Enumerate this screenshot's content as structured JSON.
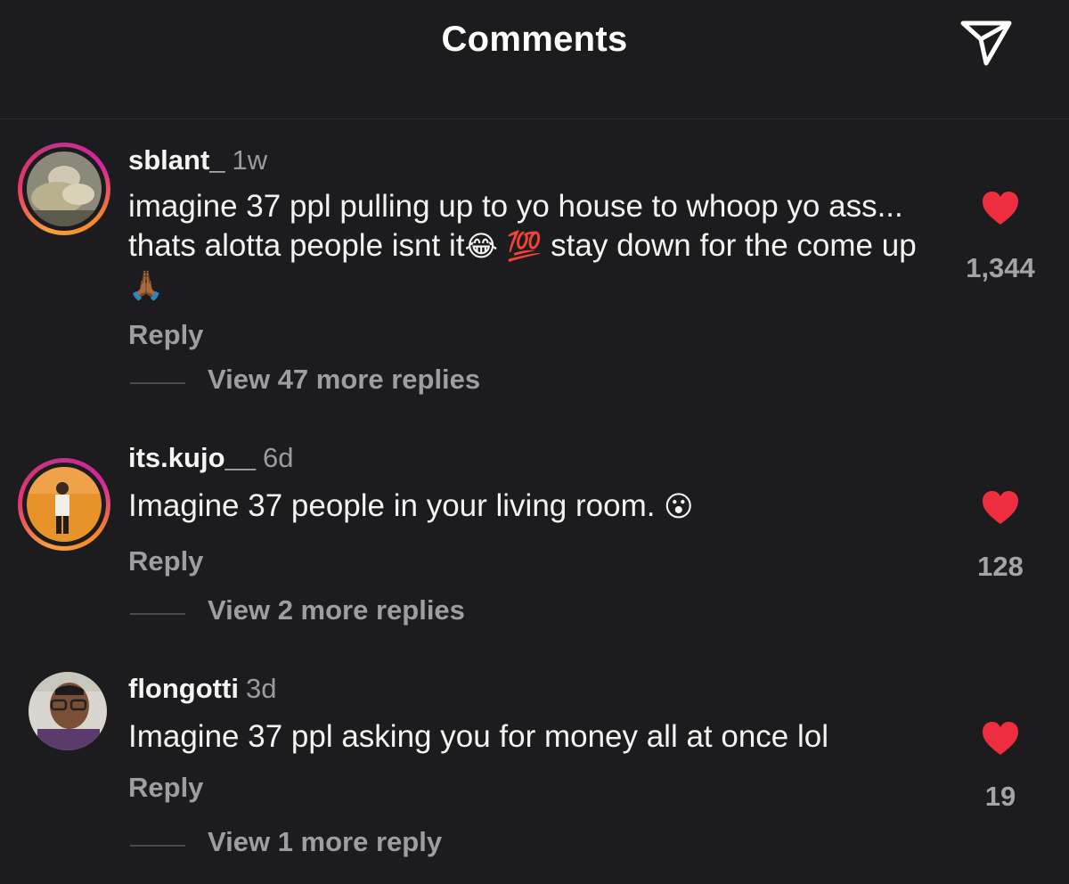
{
  "header": {
    "title": "Comments",
    "share_icon": "paper-plane-icon"
  },
  "colors": {
    "background": "#1c1c1f",
    "like_heart": "#ee2e3e",
    "muted_text": "#9d9da3",
    "story_ring": [
      "#f9a13a",
      "#e8356a",
      "#c13584"
    ]
  },
  "comments": [
    {
      "username": "sblant_",
      "time": "1w",
      "text_parts": [
        "imagine 37 ppl pulling up to yo house to whoop yo ass... thats alotta people isnt it",
        "😂",
        "💯",
        " stay down for the come up",
        "🙏🏾"
      ],
      "reply_label": "Reply",
      "view_replies": "View 47 more replies",
      "likes": "1,344",
      "liked": true,
      "avatar": "story-ring-avatar"
    },
    {
      "username": "its.kujo__",
      "time": "6d",
      "text_parts": [
        "Imagine 37 people in your living room. ",
        "😮"
      ],
      "reply_label": "Reply",
      "view_replies": "View 2 more replies",
      "likes": "128",
      "liked": true,
      "avatar": "story-ring-avatar"
    },
    {
      "username": "flongotti",
      "time": "3d",
      "text_parts": [
        "Imagine 37 ppl asking you for money all at once lol"
      ],
      "reply_label": "Reply",
      "view_replies": "View 1 more reply",
      "likes": "19",
      "liked": true,
      "avatar": "plain-avatar"
    }
  ]
}
